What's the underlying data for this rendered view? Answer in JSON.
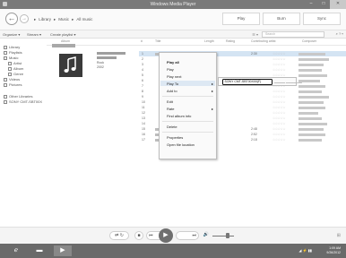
{
  "window": {
    "title": "Windows Media Player",
    "minimize": "–",
    "maximize": "□",
    "close": "✕"
  },
  "nav": {
    "back": "←",
    "forward": "→",
    "breadcrumb": [
      "▸",
      "Library",
      "▸",
      "Music",
      "▸",
      "All music"
    ],
    "tabs": [
      "Play",
      "Burn",
      "Sync"
    ]
  },
  "toolbar": {
    "organize": "Organize ▾",
    "stream": "Stream ▾",
    "create_playlist": "Create playlist ▾",
    "view_options": "☰ ▾",
    "search_placeholder": "Search",
    "search_icon": "⌕",
    "help": "? ▾"
  },
  "sidebar": {
    "items": [
      {
        "label": "Library",
        "icon": "library-icon"
      },
      {
        "label": "Playlists",
        "icon": "playlist-icon"
      },
      {
        "label": "Music",
        "icon": "music-icon"
      },
      {
        "label": "Artist",
        "icon": "artist-icon"
      },
      {
        "label": "Album",
        "icon": "album-icon"
      },
      {
        "label": "Genre",
        "icon": "genre-icon"
      },
      {
        "label": "Videos",
        "icon": "video-icon"
      },
      {
        "label": "Pictures",
        "icon": "picture-icon"
      },
      {
        "label": "Other Libraries",
        "icon": "other-libraries-icon"
      },
      {
        "label": "SONY CMT-SBT00X",
        "icon": "device-icon"
      }
    ]
  },
  "columns": {
    "album": "Album",
    "num": "#",
    "title": "Title",
    "length": "Length",
    "rating": "Rating",
    "artist": "Contributing artist",
    "composer": "Composer"
  },
  "album": {
    "genre": "Rock",
    "year": "2002"
  },
  "tracks": [
    {
      "no": "1",
      "length": "2:30",
      "rating": "☆☆☆☆☆"
    },
    {
      "no": "2",
      "length": "",
      "rating": "☆☆☆☆☆"
    },
    {
      "no": "3",
      "length": "",
      "rating": "☆☆☆☆☆"
    },
    {
      "no": "4",
      "length": "",
      "rating": "☆☆☆☆☆"
    },
    {
      "no": "5",
      "length": "",
      "rating": "☆☆☆☆☆"
    },
    {
      "no": "6",
      "length": "",
      "rating": "☆☆☆☆☆"
    },
    {
      "no": "7",
      "length": "",
      "rating": "☆☆☆☆☆"
    },
    {
      "no": "8",
      "length": "",
      "rating": "☆☆☆☆☆"
    },
    {
      "no": "9",
      "length": "",
      "rating": "☆☆☆☆☆"
    },
    {
      "no": "10",
      "length": "",
      "rating": "☆☆☆☆☆"
    },
    {
      "no": "11",
      "length": "",
      "rating": "☆☆☆☆☆"
    },
    {
      "no": "12",
      "length": "",
      "rating": "☆☆☆☆☆"
    },
    {
      "no": "13",
      "length": "",
      "rating": "☆☆☆☆☆"
    },
    {
      "no": "14",
      "length": "",
      "rating": "☆☆☆☆☆"
    },
    {
      "no": "15",
      "length": "2:48",
      "rating": "☆☆☆☆☆"
    },
    {
      "no": "16",
      "length": "2:52",
      "rating": "☆☆☆☆☆"
    },
    {
      "no": "17",
      "length": "2:18",
      "rating": "☆☆☆☆☆"
    }
  ],
  "context_menu": {
    "play_all": "Play all",
    "play": "Play",
    "play_next": "Play next",
    "play_to": "Play To",
    "add_to": "Add to",
    "edit": "Edit",
    "rate": "Rate",
    "find_album_info": "Find album info",
    "delete": "Delete",
    "properties": "Properties",
    "open_file_location": "Open file location",
    "arrow": "▸"
  },
  "submenu": {
    "device": "SONY CMT-SBT00X00(F)"
  },
  "player": {
    "shuffle": "⇄",
    "repeat": "↻",
    "stop": "■",
    "prev": "⏮",
    "play": "▶",
    "next": "⏭",
    "mute": "🔊",
    "switch_view": "⊞"
  },
  "taskbar": {
    "start": "ℯ",
    "explorer": "▬",
    "wmp": "▶",
    "tray": "◢ ⚡ ▮▮",
    "time": "1:09 AM",
    "date": "9/26/2012"
  }
}
